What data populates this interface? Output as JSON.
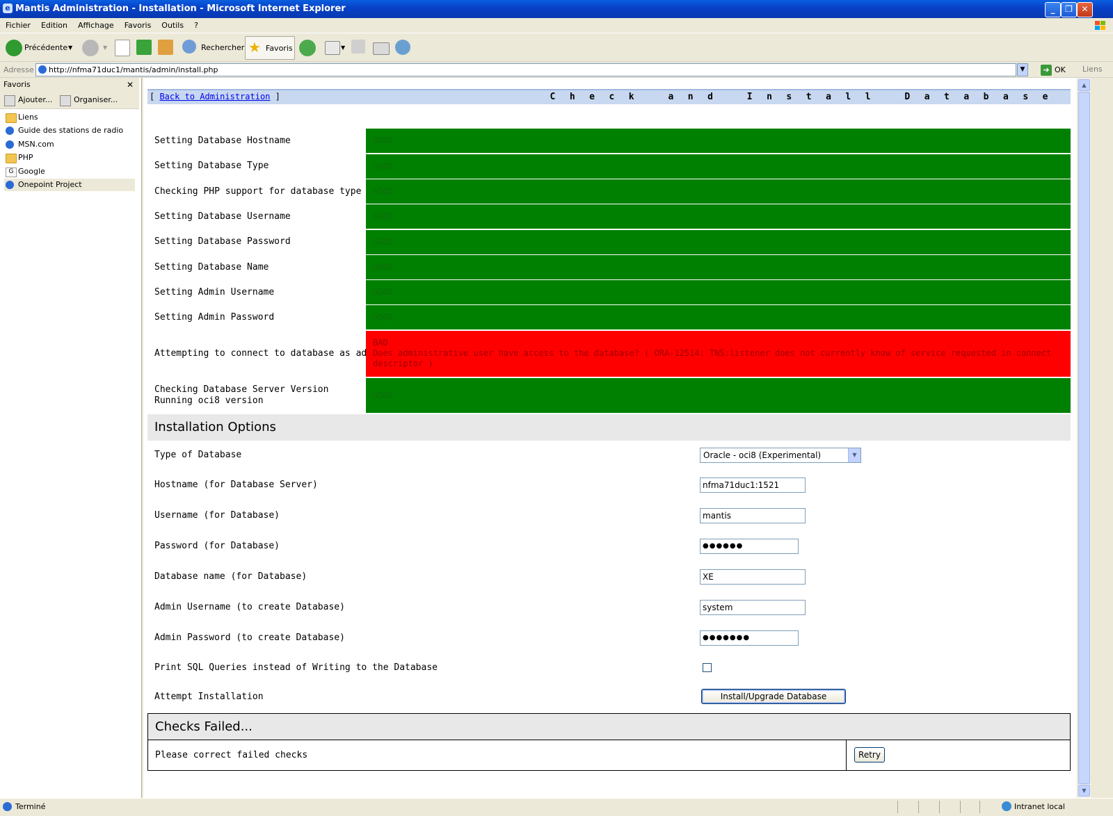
{
  "window": {
    "title": "Mantis Administration - Installation - Microsoft Internet Explorer"
  },
  "menu": [
    "Fichier",
    "Edition",
    "Affichage",
    "Favoris",
    "Outils",
    "?"
  ],
  "toolbar": {
    "back_label": "Précédente",
    "search_label": "Rechercher",
    "favorites_label": "Favoris"
  },
  "address": {
    "label": "Adresse",
    "url": "http://nfma71duc1/mantis/admin/install.php",
    "go_label": "OK",
    "links_label": "Liens"
  },
  "favorites": {
    "title": "Favoris",
    "add_label": "Ajouter...",
    "organize_label": "Organiser...",
    "items": [
      {
        "label": "Liens",
        "icon": "folder-icon"
      },
      {
        "label": "Guide des stations de radio",
        "icon": "ie-page-icon"
      },
      {
        "label": "MSN.com",
        "icon": "ie-page-icon"
      },
      {
        "label": "PHP",
        "icon": "folder-icon"
      },
      {
        "label": "Google",
        "icon": "google-icon"
      },
      {
        "label": "Onepoint Project",
        "icon": "ie-page-icon"
      }
    ]
  },
  "page": {
    "back_link_pre": "[ ",
    "back_link": "Back to Administration",
    "back_link_post": " ]",
    "title": "Check and Install Database",
    "checks": [
      {
        "label": "Setting Database Hostname",
        "result": "GOOD",
        "status": "good"
      },
      {
        "label": "Setting Database Type",
        "result": "GOOD",
        "status": "good"
      },
      {
        "label": "Checking PHP support for database type",
        "result": "GOOD",
        "status": "good"
      },
      {
        "label": "Setting Database Username",
        "result": "GOOD",
        "status": "good"
      },
      {
        "label": "Setting Database Password",
        "result": "GOOD",
        "status": "good"
      },
      {
        "label": "Setting Database Name",
        "result": "GOOD",
        "status": "good"
      },
      {
        "label": "Setting Admin Username",
        "result": "GOOD",
        "status": "good"
      },
      {
        "label": "Setting Admin Password",
        "result": "GOOD",
        "status": "good"
      },
      {
        "label": "Attempting to connect to database as admin",
        "result": "BAD",
        "detail": "Does administrative user have access to the database? ( ORA-12514: TNS:listener does not currently know of service requested in connect descriptor )",
        "status": "bad"
      },
      {
        "label": "Checking Database Server Version",
        "label2": "Running oci8 version",
        "result": "GOOD",
        "status": "good"
      }
    ],
    "options_title": "Installation Options",
    "options": {
      "db_type_label": "Type of Database",
      "db_type_value": "Oracle - oci8 (Experimental)",
      "hostname_label": "Hostname (for Database Server)",
      "hostname_value": "nfma71duc1:1521",
      "username_label": "Username (for Database)",
      "username_value": "mantis",
      "password_label": "Password (for Database)",
      "password_value": "●●●●●●",
      "dbname_label": "Database name (for Database)",
      "dbname_value": "XE",
      "admin_user_label": "Admin Username (to create Database)",
      "admin_user_value": "system",
      "admin_pass_label": "Admin Password (to create Database)",
      "admin_pass_value": "●●●●●●●",
      "print_sql_label": "Print SQL Queries instead of Writing to the Database",
      "print_sql_checked": false,
      "attempt_label": "Attempt Installation",
      "install_button": "Install/Upgrade Database"
    },
    "failed_title": "Checks Failed...",
    "failed_message": "Please correct failed checks",
    "retry_button": "Retry"
  },
  "status": {
    "text": "Terminé",
    "zone": "Intranet local"
  },
  "colors": {
    "good": "#008000",
    "bad": "#ff0000",
    "header_bar": "#c8d8f0",
    "title_bar": "#0842c8"
  }
}
